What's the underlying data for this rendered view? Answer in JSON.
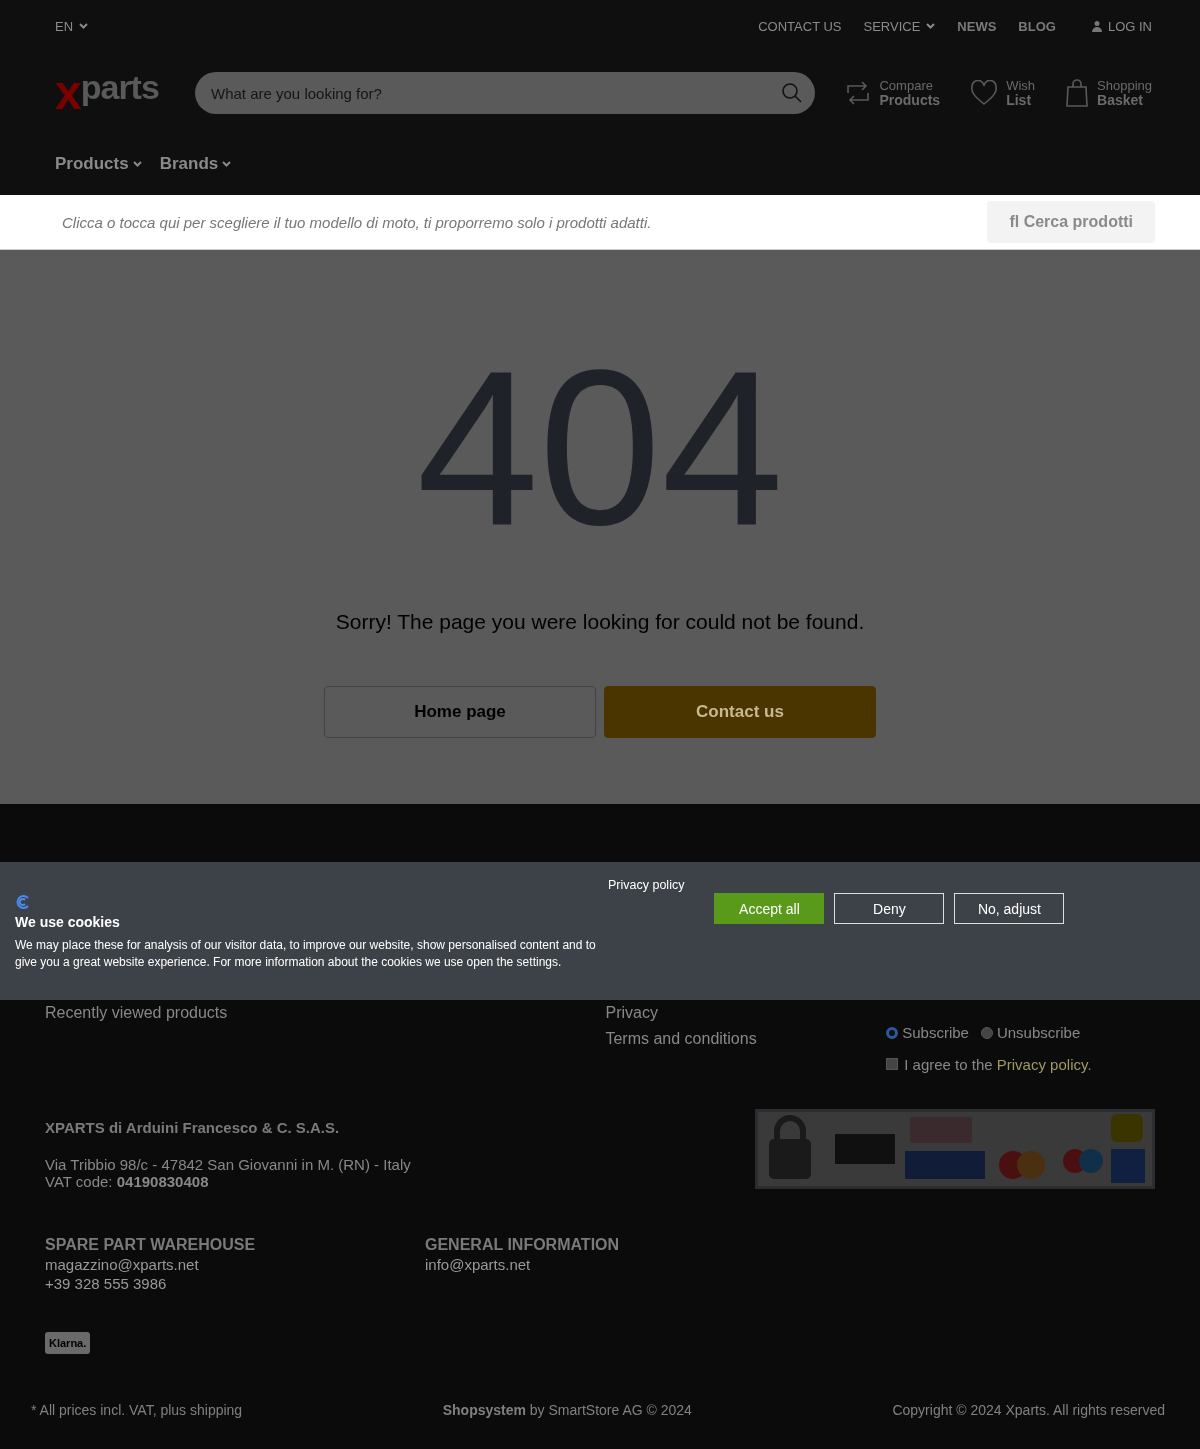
{
  "topbar": {
    "language": "EN",
    "links": [
      {
        "label": "CONTACT US",
        "kind": "plain"
      },
      {
        "label": "SERVICE",
        "kind": "dropdown"
      },
      {
        "label": "NEWS",
        "kind": "bold"
      },
      {
        "label": "BLOG",
        "kind": "bold"
      },
      {
        "label": "LOG IN",
        "kind": "user"
      }
    ]
  },
  "header": {
    "logo_red": "x",
    "logo_text": "parts",
    "search": {
      "placeholder": "What are you looking for?"
    },
    "actions": [
      {
        "kind": "compare",
        "line1": "Compare",
        "line2": "Products"
      },
      {
        "kind": "heart",
        "line1": "Wish",
        "line2": "List"
      },
      {
        "kind": "bag",
        "line1": "Shopping",
        "line2": "Basket"
      }
    ]
  },
  "nav": [
    "Products",
    "Brands"
  ],
  "notice": {
    "text": "Clicca o tocca qui per scegliere il tuo modello di moto, ti proporremo solo i prodotti adatti.",
    "button_icon": "fl",
    "button": "Cerca prodotti"
  },
  "error": {
    "code": "404",
    "message": "Sorry! The page you were looking for could not be found.",
    "buttons": [
      {
        "label": "Home page",
        "kind": "outline"
      },
      {
        "label": "Contact us",
        "kind": "primary"
      }
    ]
  },
  "footer": {
    "left_links": [
      "Recently viewed products"
    ],
    "mid_links": [
      "Privacy",
      "Terms and conditions"
    ],
    "newsletter": {
      "options": [
        {
          "label": "Subscribe",
          "selected": true
        },
        {
          "label": "Unsubscribe",
          "selected": false
        }
      ],
      "agree": {
        "checked": false,
        "text": "I agree to the",
        "link": "Privacy policy",
        "end": "."
      }
    },
    "company": {
      "name": "XPARTS di Arduini Francesco & C. S.A.S.",
      "address": "Via Tribbio 98/c - 47842 San Giovanni in M. (RN) - Italy",
      "vat_label": "VAT code:",
      "vat": "04190830408"
    },
    "contacts": [
      {
        "title": "SPARE PART WAREHOUSE",
        "lines": [
          "magazzino@xparts.net",
          "+39 328 555 3986"
        ]
      },
      {
        "title": "GENERAL INFORMATION",
        "lines": [
          "info@xparts.net"
        ]
      }
    ],
    "klarna": "Klarna.",
    "bottom": {
      "left": "* All prices incl. VAT, plus shipping",
      "mid_bold": "Shopsystem",
      "mid": "by SmartStore AG © 2024",
      "right": "Copyright © 2024 Xparts. All rights reserved"
    }
  },
  "cookie_banner": {
    "privacy_link": "Privacy policy",
    "title": "We use cookies",
    "text": "We may place these for analysis of our visitor data, to improve our website, show personalised content and to give you a great website experience. For more information about the cookies we use open the settings.",
    "buttons": [
      {
        "label": "Accept all",
        "kind": "primary"
      },
      {
        "label": "Deny",
        "kind": "outline"
      },
      {
        "label": "No, adjust",
        "kind": "outline"
      }
    ]
  }
}
